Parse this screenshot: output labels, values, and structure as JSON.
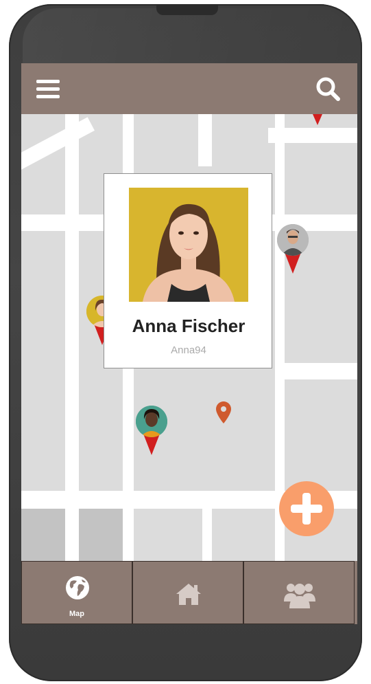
{
  "topbar": {
    "menu_icon": "hamburger-icon",
    "search_icon": "search-icon"
  },
  "popup": {
    "name": "Anna Fischer",
    "username": "Anna94"
  },
  "bottom_nav": {
    "tabs": [
      {
        "icon": "globe-icon",
        "label": "Map",
        "active": true
      },
      {
        "icon": "home-icon",
        "label": ""
      },
      {
        "icon": "users-icon",
        "label": ""
      }
    ]
  },
  "fab": {
    "icon": "plus-icon"
  },
  "colors": {
    "bar": "#8c7a72",
    "fab": "#f99e6b",
    "pin": "#d11f1f",
    "location_pin": "#cf5a2e"
  }
}
